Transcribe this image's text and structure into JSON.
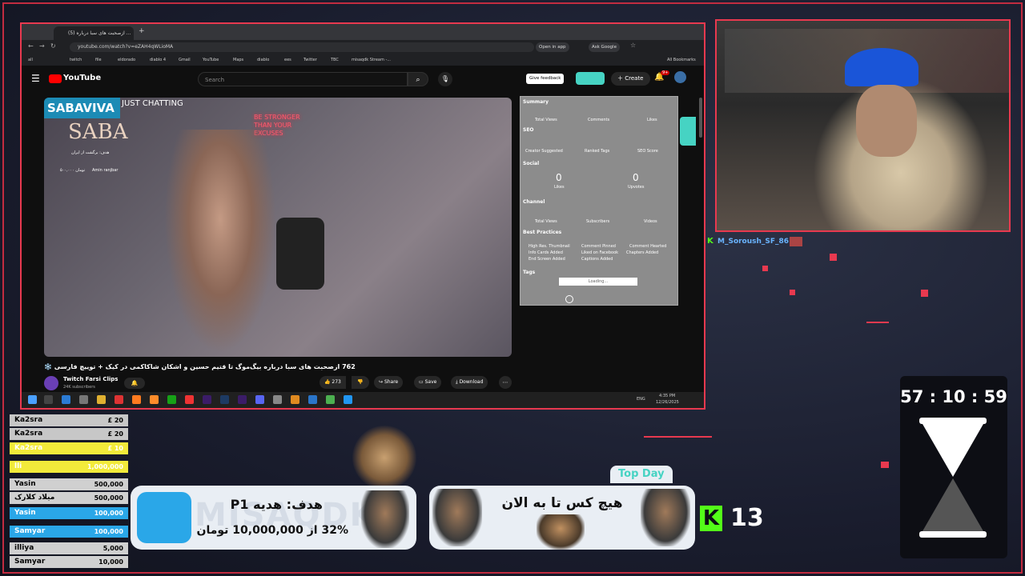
{
  "browser": {
    "tab_title": "(5) ازصحبت های سبا درباره ...",
    "url": "youtube.com/watch?v=eZAH4qWLioMA",
    "open_in_app": "Open in app",
    "ask_google": "Ask Google",
    "bookmarks": [
      "all",
      "twitch",
      "file",
      "eldorado",
      "diablo 4",
      "Gmail",
      "YouTube",
      "Maps",
      "diablo",
      "ees",
      "Twitter",
      "TBC",
      "misaqdk Stream -..."
    ],
    "all_bookmarks": "All Bookmarks"
  },
  "youtube": {
    "logo": "YouTube",
    "search_placeholder": "Search",
    "give_feedback": "Give feedback",
    "create": "Create",
    "notifications_count": "9+",
    "video_title": "762 ازصحبت های سبا درباره بیگ‌موگ تا قتیم حسین و اشکان شاکاکمی در کیک + توییچ فارسی ❄️",
    "channel_name": "Twitch Farsi Clips",
    "subscribers": "24K subscribers",
    "likes": "273",
    "share": "Share",
    "save": "Save",
    "download": "Download",
    "overlay_channel": "SABAVIVA",
    "overlay_category": "JUST CHATTING",
    "overlay_logo": "SABA",
    "overlay_goal": "هدف: برگشت از ایران",
    "overlay_donor": "Amin ranjbar",
    "overlay_amount": "۵۰۰,۰۰۰ تومان",
    "neon_text": "BE STRONGER THAN YOUR EXCUSES"
  },
  "panel": {
    "summary": "Summary",
    "total_views": "Total Views",
    "comments": "Comments",
    "likes": "Likes",
    "seo": "SEO",
    "creator_suggested": "Creator Suggested",
    "ranked_tags": "Ranked Tags",
    "seo_score": "SEO Score",
    "social": "Social",
    "social_likes_val": "0",
    "social_likes": "Likes",
    "upvotes_val": "0",
    "upvotes": "Upvotes",
    "channel": "Channel",
    "ch_total_views": "Total Views",
    "ch_subscribers": "Subscribers",
    "ch_videos": "Videos",
    "best_practices": "Best Practices",
    "bp": [
      "High Res. Thumbnail",
      "Comment Pinned",
      "Comment Hearted",
      "Info Cards Added",
      "Liked on Facebook",
      "Chapters Added",
      "End Screen Added",
      "Captions Added"
    ],
    "tags": "Tags",
    "loading": "Loading..."
  },
  "taskbar": {
    "lang": "ENG",
    "time": "4:35 PM",
    "date": "12/26/2025"
  },
  "webcam": {
    "chat_user": "M_Soroush_SF_86"
  },
  "donations": [
    {
      "name": "Ka2sra",
      "amount": "£ 20",
      "color": "#c7c7c7",
      "text": "#000"
    },
    {
      "name": "Ka2sra",
      "amount": "£ 20",
      "color": "#c7c7c7",
      "text": "#000"
    },
    {
      "name": "Ka2sra",
      "amount": "£ 10",
      "color": "#f2ea3a",
      "text": "#fff"
    },
    {
      "name": "lli",
      "amount": "1,000,000",
      "color": "#f2ea3a",
      "text": "#fff"
    },
    {
      "name": "Yasin",
      "amount": "500,000",
      "color": "#d0d0d0",
      "text": "#000"
    },
    {
      "name": "میلاد کلارک",
      "amount": "500,000",
      "color": "#d0d0d0",
      "text": "#000"
    },
    {
      "name": "Yasin",
      "amount": "100,000",
      "color": "#2aa7e8",
      "text": "#fff"
    },
    {
      "name": "Samyar",
      "amount": "100,000",
      "color": "#2aa7e8",
      "text": "#fff"
    },
    {
      "name": "illiya",
      "amount": "5,000",
      "color": "#d0d0d0",
      "text": "#000"
    },
    {
      "name": "Samyar",
      "amount": "10,000",
      "color": "#d0d0d0",
      "text": "#000"
    }
  ],
  "goal": {
    "watermark": "MISAQDK",
    "title": "هدف: هدیه P1",
    "progress_text": "32% از 10,000,000 تومان",
    "progress_fraction": 0.32
  },
  "topday": {
    "label": "Top Day",
    "text": "هیچ کس تا به الان"
  },
  "kick": {
    "count": "13",
    "color": "#53fc18"
  },
  "timer": {
    "value": "57 : 10 : 59"
  },
  "colors": {
    "accent_red": "#e8394f",
    "teal": "#46d3c3"
  }
}
